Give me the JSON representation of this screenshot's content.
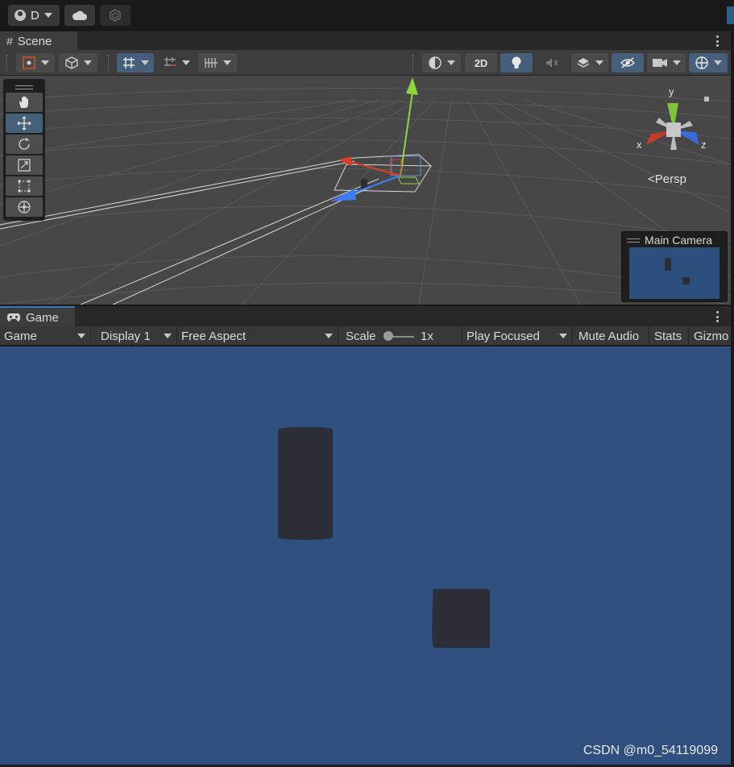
{
  "topbar": {
    "account_label": "D",
    "icons": [
      "user-icon",
      "chevron-down-icon",
      "cloud-icon",
      "collab-icon"
    ]
  },
  "scene_tab": {
    "label": "Scene",
    "icon": "grid-icon"
  },
  "scene_toolbar": {
    "two_d_label": "2D"
  },
  "scene_view": {
    "tools": [
      "hand-tool",
      "move-tool",
      "rotate-tool",
      "scale-tool",
      "rect-tool",
      "transform-tool"
    ],
    "selected_tool": "move-tool",
    "gizmo_axes": {
      "x": "x",
      "y": "y",
      "z": "z"
    },
    "projection_label": "Persp",
    "camera_preview_title": "Main Camera"
  },
  "game_tab": {
    "label": "Game",
    "icon": "gamepad-icon"
  },
  "game_toolbar": {
    "mode": "Game",
    "display": "Display 1",
    "aspect": "Free Aspect",
    "scale_label": "Scale",
    "scale_value": "1x",
    "play_mode": "Play Focused",
    "mute_audio": "Mute Audio",
    "stats": "Stats",
    "gizmos": "Gizmo"
  },
  "watermark": "CSDN @m0_54119099",
  "colors": {
    "game_background": "#2f4f7e",
    "scene_background": "#474747",
    "accent_selected": "#46607c",
    "x_axis": "#d9402c",
    "y_axis": "#8fd63c",
    "z_axis": "#3c7cf0"
  }
}
